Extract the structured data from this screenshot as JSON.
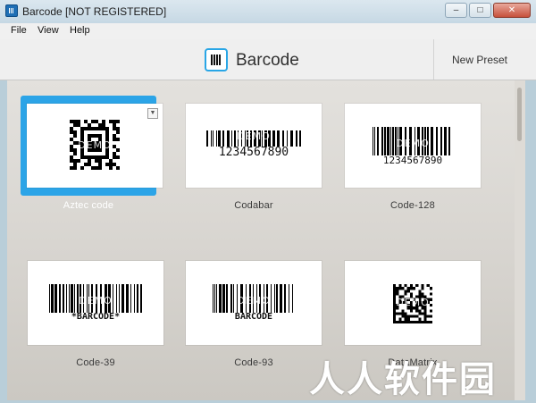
{
  "window": {
    "title": "Barcode [NOT REGISTERED]",
    "minimize_icon": "minimize-icon",
    "maximize_icon": "maximize-icon",
    "close_icon": "close-icon"
  },
  "menu": [
    "File",
    "View",
    "Help"
  ],
  "toolbar": {
    "app_name": "Barcode",
    "new_preset": "New Preset",
    "accent": "#29a6e6"
  },
  "presets": [
    {
      "label": "Aztec code",
      "selected": true,
      "kind": "2d",
      "demo": "DEMO"
    },
    {
      "label": "Codabar",
      "selected": false,
      "kind": "linear",
      "digits": "1234567890",
      "demo": "DEMO"
    },
    {
      "label": "Code-128",
      "selected": false,
      "kind": "linear",
      "digits": "1234567890",
      "demo": "DEMO"
    },
    {
      "label": "Code-39",
      "selected": false,
      "kind": "linear",
      "digits": "*BARCODE*",
      "demo": "DEMO"
    },
    {
      "label": "Code-93",
      "selected": false,
      "kind": "linear",
      "digits": "BARCODE",
      "demo": "DEMO"
    },
    {
      "label": "DataMatrix",
      "selected": false,
      "kind": "2d",
      "demo": "DEMO"
    }
  ],
  "watermark": "人人软件园",
  "colors": {
    "selected_tile": "#2ca4e7",
    "content_bg": "#dedbd6"
  }
}
